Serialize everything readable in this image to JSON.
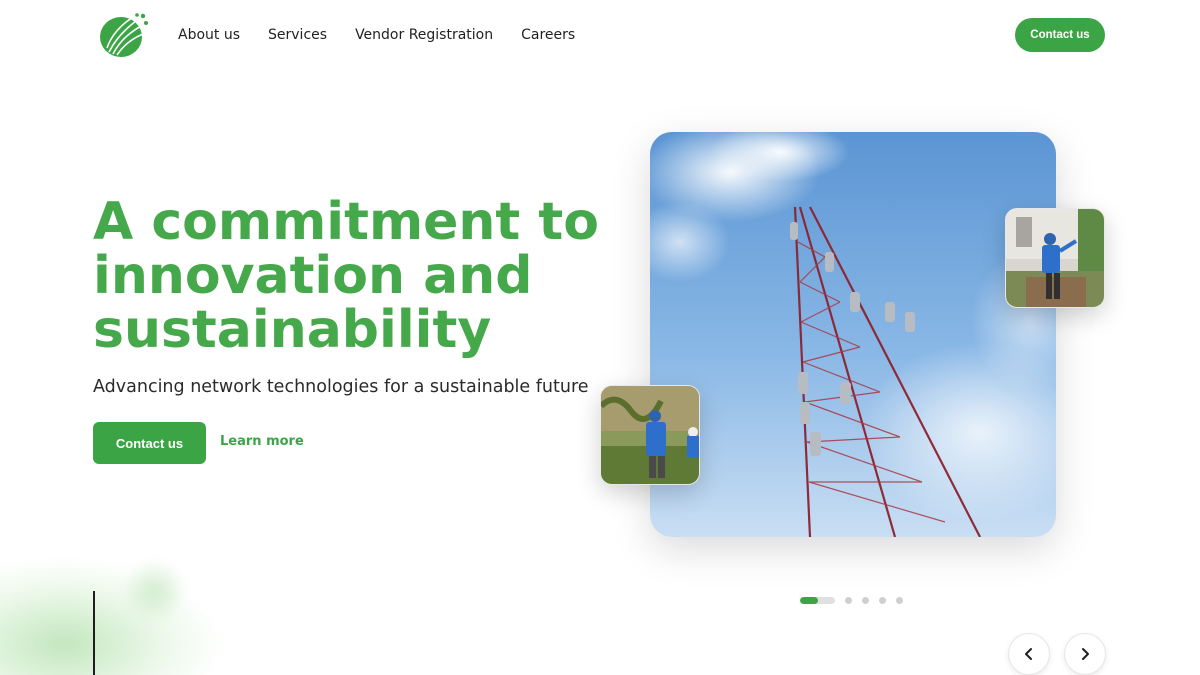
{
  "header": {
    "logo_icon": "leaf-fiber-logo",
    "nav": [
      {
        "label": "About us"
      },
      {
        "label": "Services"
      },
      {
        "label": "Vendor Registration"
      },
      {
        "label": "Careers"
      }
    ],
    "contact_button": "Contact us"
  },
  "hero": {
    "title_lines": [
      "A commitment to",
      "innovation and",
      "sustainability"
    ],
    "subtitle": "Advancing network technologies for a sustainable future",
    "primary_button": "Contact us",
    "secondary_link": "Learn more"
  },
  "gallery": {
    "main_image": "telecom-tower-photo",
    "thumb_right": "technician-yard-photo",
    "thumb_left": "technicians-field-photo"
  },
  "carousel": {
    "slide_count": 5,
    "active_index": 0,
    "active_progress": 0.5,
    "prev_icon": "chevron-left-icon",
    "next_icon": "chevron-right-icon"
  },
  "colors": {
    "brand_green": "#3ba545",
    "title_green": "#45a84a",
    "text_dark": "#1e1e1e"
  }
}
